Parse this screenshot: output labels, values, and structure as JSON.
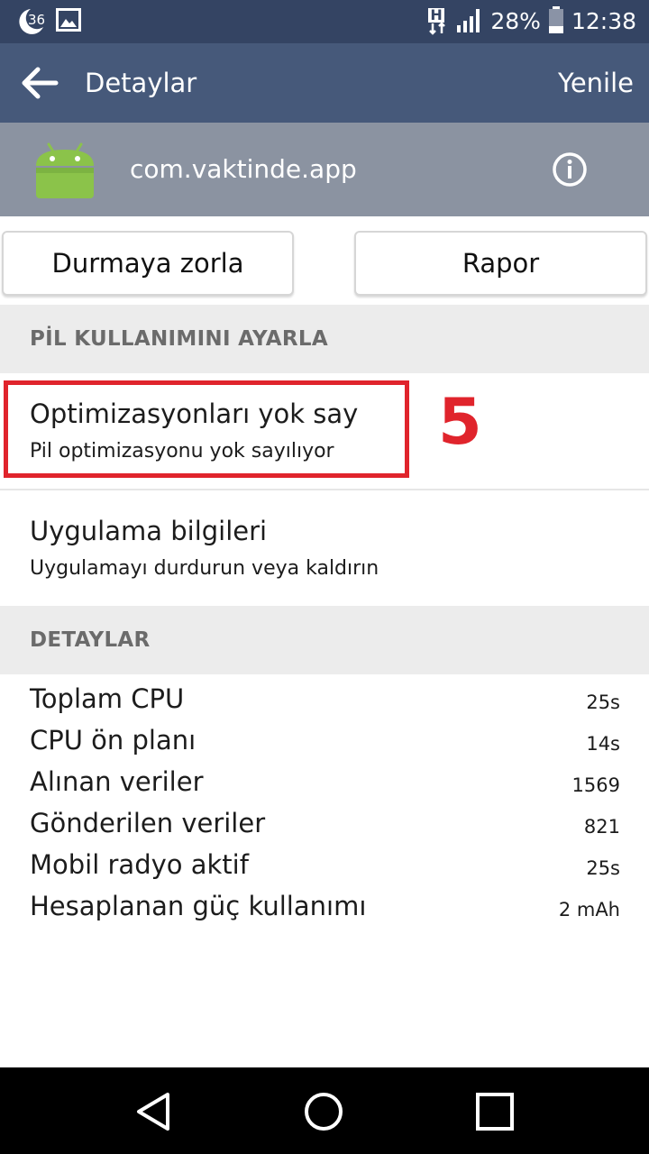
{
  "status_bar": {
    "notification_badge": "36",
    "battery_percent": "28%",
    "time": "12:38",
    "network_indicator": "H"
  },
  "app_bar": {
    "title": "Detaylar",
    "action": "Yenile"
  },
  "app_header": {
    "package_name": "com.vaktinde.app"
  },
  "buttons": {
    "force_stop": "Durmaya zorla",
    "report": "Rapor"
  },
  "battery_section": {
    "header": "PİL KULLANIMINI AYARLA",
    "items": [
      {
        "title": "Optimizasyonları yok say",
        "subtitle": "Pil optimizasyonu yok sayılıyor"
      },
      {
        "title": "Uygulama bilgileri",
        "subtitle": "Uygulamayı durdurun veya kaldırın"
      }
    ]
  },
  "annotation": {
    "step_number": "5"
  },
  "details_section": {
    "header": "DETAYLAR",
    "rows": [
      {
        "label": "Toplam CPU",
        "value": "25s"
      },
      {
        "label": "CPU ön planı",
        "value": "14s"
      },
      {
        "label": "Alınan veriler",
        "value": "1569"
      },
      {
        "label": "Gönderilen veriler",
        "value": "821"
      },
      {
        "label": "Mobil radyo aktif",
        "value": "25s"
      },
      {
        "label": "Hesaplanan güç kullanımı",
        "value": "2 mAh"
      }
    ]
  },
  "colors": {
    "status_bar": "#344463",
    "app_bar": "#46597a",
    "app_header": "#8b93a1",
    "annotation_red": "#e0242c",
    "android_green": "#8bc34a"
  },
  "icons": {
    "back": "arrow-left-icon",
    "app": "android-icon",
    "info": "info-icon",
    "nav_back": "triangle-back-icon",
    "nav_home": "circle-home-icon",
    "nav_recents": "square-recents-icon"
  }
}
